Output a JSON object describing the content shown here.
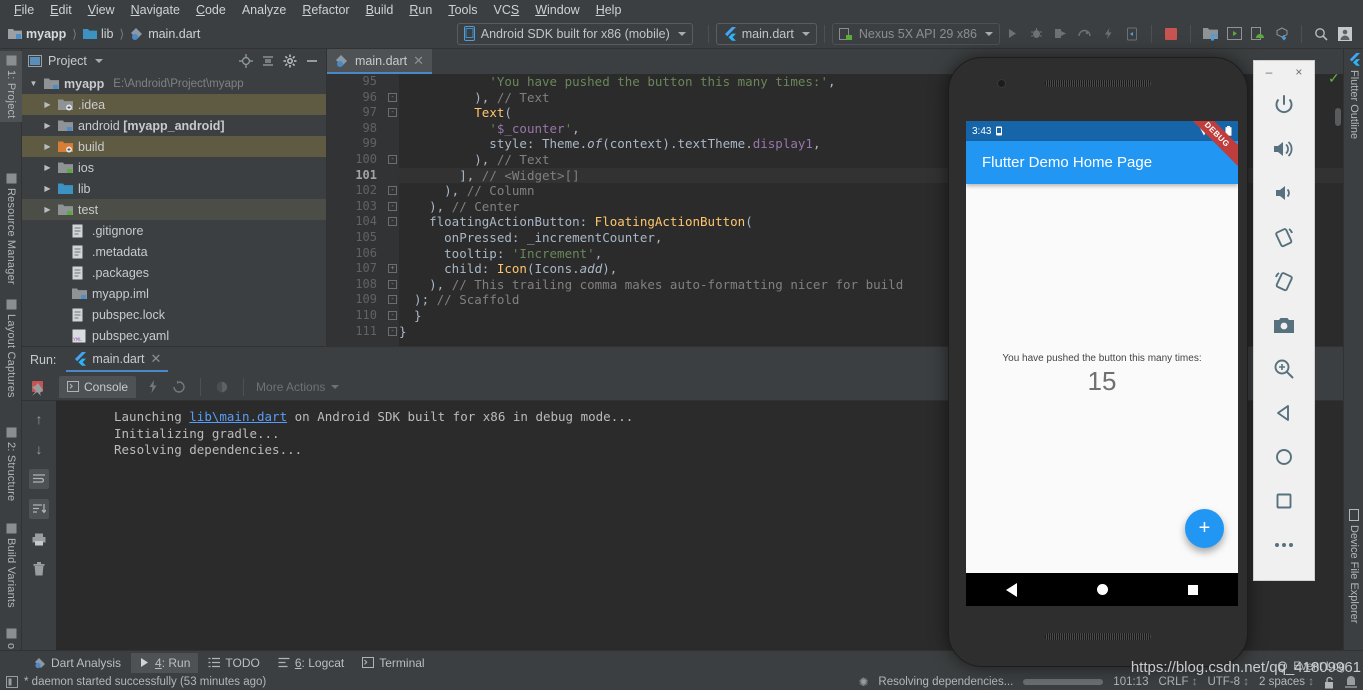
{
  "menu": {
    "items": [
      "File",
      "Edit",
      "View",
      "Navigate",
      "Code",
      "Analyze",
      "Refactor",
      "Build",
      "Run",
      "Tools",
      "VCS",
      "Window",
      "Help"
    ]
  },
  "toolbar": {
    "breadcrumbs": [
      "myapp",
      "lib",
      "main.dart"
    ],
    "device_combo": "Android SDK built for x86 (mobile)",
    "config_combo": "main.dart",
    "avd_combo": "Nexus 5X API 29 x86"
  },
  "left_rail": {
    "items": [
      "1: Project",
      "Resource Manager",
      "Layout Captures",
      "2: Structure",
      "Build Variants",
      "orites"
    ]
  },
  "right_rail": {
    "items": [
      "Flutter Outline",
      "Device File Explorer"
    ]
  },
  "project_panel": {
    "title": "Project",
    "tree": [
      {
        "label": "myapp",
        "path": "E:\\Android\\Project\\myapp",
        "indent": 0,
        "arrow": "down",
        "icon": "module-folder",
        "bold": true,
        "highlight": ""
      },
      {
        "label": ".idea",
        "path": "",
        "indent": 1,
        "arrow": "right",
        "icon": "idea-folder",
        "bold": false,
        "highlight": "a"
      },
      {
        "label": "android [myapp_android]",
        "path": "",
        "indent": 1,
        "arrow": "right",
        "icon": "module-folder",
        "bold": false,
        "highlight": ""
      },
      {
        "label": "build",
        "path": "",
        "indent": 1,
        "arrow": "right",
        "icon": "build-folder",
        "bold": false,
        "highlight": "a"
      },
      {
        "label": "ios",
        "path": "",
        "indent": 1,
        "arrow": "right",
        "icon": "ios-folder",
        "bold": false,
        "highlight": ""
      },
      {
        "label": "lib",
        "path": "",
        "indent": 1,
        "arrow": "right",
        "icon": "source-folder",
        "bold": false,
        "highlight": ""
      },
      {
        "label": "test",
        "path": "",
        "indent": 1,
        "arrow": "right",
        "icon": "test-folder",
        "bold": false,
        "highlight": "b"
      },
      {
        "label": ".gitignore",
        "path": "",
        "indent": 2,
        "arrow": "",
        "icon": "file",
        "bold": false,
        "highlight": ""
      },
      {
        "label": ".metadata",
        "path": "",
        "indent": 2,
        "arrow": "",
        "icon": "file",
        "bold": false,
        "highlight": ""
      },
      {
        "label": ".packages",
        "path": "",
        "indent": 2,
        "arrow": "",
        "icon": "file",
        "bold": false,
        "highlight": ""
      },
      {
        "label": "myapp.iml",
        "path": "",
        "indent": 2,
        "arrow": "",
        "icon": "module-folder",
        "bold": false,
        "highlight": ""
      },
      {
        "label": "pubspec.lock",
        "path": "",
        "indent": 2,
        "arrow": "",
        "icon": "file",
        "bold": false,
        "highlight": ""
      },
      {
        "label": "pubspec.yaml",
        "path": "",
        "indent": 2,
        "arrow": "",
        "icon": "yaml",
        "bold": false,
        "highlight": ""
      }
    ]
  },
  "editor": {
    "tab": "main.dart",
    "current_line": 101,
    "lines": [
      {
        "n": 95,
        "fold": "",
        "text": "            'You have pushed the button this many times:',",
        "segs": [
          {
            "t": "            ",
            "c": "pl"
          },
          {
            "t": "'You have pushed the button this many times:'",
            "c": "str"
          },
          {
            "t": ",",
            "c": "pl"
          }
        ]
      },
      {
        "n": 96,
        "fold": "-",
        "text": "          ), // Text",
        "segs": [
          {
            "t": "          ), ",
            "c": "pl"
          },
          {
            "t": "// Text",
            "c": "cm"
          }
        ]
      },
      {
        "n": 97,
        "fold": "-",
        "text": "          Text(",
        "segs": [
          {
            "t": "          ",
            "c": "pl"
          },
          {
            "t": "Text",
            "c": "cls"
          },
          {
            "t": "(",
            "c": "pl"
          }
        ]
      },
      {
        "n": 98,
        "fold": "",
        "text": "            '$_counter',",
        "segs": [
          {
            "t": "            ",
            "c": "pl"
          },
          {
            "t": "'",
            "c": "str"
          },
          {
            "t": "$_counter",
            "c": "fld"
          },
          {
            "t": "'",
            "c": "str"
          },
          {
            "t": ",",
            "c": "pl"
          }
        ]
      },
      {
        "n": 99,
        "fold": "",
        "text": "            style: Theme.of(context).textTheme.display1,",
        "segs": [
          {
            "t": "            style: Theme.",
            "c": "pl"
          },
          {
            "t": "of",
            "c": "it"
          },
          {
            "t": "(context).textTheme.",
            "c": "pl"
          },
          {
            "t": "display1",
            "c": "fld"
          },
          {
            "t": ",",
            "c": "pl"
          }
        ]
      },
      {
        "n": 100,
        "fold": "-",
        "text": "          ), // Text",
        "segs": [
          {
            "t": "          ), ",
            "c": "pl"
          },
          {
            "t": "// Text",
            "c": "cm"
          }
        ]
      },
      {
        "n": 101,
        "fold": "",
        "text": "        ], // <Widget>[]",
        "segs": [
          {
            "t": "        ], ",
            "c": "pl"
          },
          {
            "t": "// <Widget>[]",
            "c": "cm"
          }
        ]
      },
      {
        "n": 102,
        "fold": "-",
        "text": "      ), // Column",
        "segs": [
          {
            "t": "      ), ",
            "c": "pl"
          },
          {
            "t": "// Column",
            "c": "cm"
          }
        ]
      },
      {
        "n": 103,
        "fold": "-",
        "text": "    ), // Center",
        "segs": [
          {
            "t": "    ), ",
            "c": "pl"
          },
          {
            "t": "// Center",
            "c": "cm"
          }
        ]
      },
      {
        "n": 104,
        "fold": "-",
        "text": "    floatingActionButton: FloatingActionButton(",
        "segs": [
          {
            "t": "    floatingActionButton: ",
            "c": "pl"
          },
          {
            "t": "FloatingActionButton",
            "c": "cls"
          },
          {
            "t": "(",
            "c": "pl"
          }
        ]
      },
      {
        "n": 105,
        "fold": "",
        "text": "      onPressed: _incrementCounter,",
        "segs": [
          {
            "t": "      onPressed: ",
            "c": "pl"
          },
          {
            "t": "_incrementCounter",
            "c": "pl"
          },
          {
            "t": ",",
            "c": "pl"
          }
        ]
      },
      {
        "n": 106,
        "fold": "",
        "text": "      tooltip: 'Increment',",
        "segs": [
          {
            "t": "      tooltip: ",
            "c": "pl"
          },
          {
            "t": "'Increment'",
            "c": "str"
          },
          {
            "t": ",",
            "c": "pl"
          }
        ]
      },
      {
        "n": 107,
        "fold": "+",
        "text": "      child: Icon(Icons.add),",
        "segs": [
          {
            "t": "      child: ",
            "c": "pl"
          },
          {
            "t": "Icon",
            "c": "cls"
          },
          {
            "t": "(Icons.",
            "c": "pl"
          },
          {
            "t": "add",
            "c": "it"
          },
          {
            "t": "),",
            "c": "pl"
          }
        ]
      },
      {
        "n": 108,
        "fold": "-",
        "text": "    ), // This trailing comma makes auto-formatting nicer for build",
        "segs": [
          {
            "t": "    ), ",
            "c": "pl"
          },
          {
            "t": "// This trailing comma makes auto-formatting nicer for build",
            "c": "cm"
          }
        ]
      },
      {
        "n": 109,
        "fold": "-",
        "text": "  ); // Scaffold",
        "segs": [
          {
            "t": "  ); ",
            "c": "pl"
          },
          {
            "t": "// Scaffold",
            "c": "cm"
          }
        ]
      },
      {
        "n": 110,
        "fold": "-",
        "text": "  }",
        "segs": [
          {
            "t": "  }",
            "c": "pl"
          }
        ]
      },
      {
        "n": 111,
        "fold": "-",
        "text": "}",
        "segs": [
          {
            "t": "}",
            "c": "pl"
          }
        ]
      }
    ]
  },
  "run_panel": {
    "label": "Run:",
    "tab": "main.dart",
    "console_tab": "Console",
    "more_actions": "More Actions",
    "output": [
      {
        "pre": "Launching ",
        "link": "lib\\main.dart",
        "post": " on Android SDK built for x86 in debug mode..."
      },
      {
        "pre": "Initializing gradle...",
        "link": "",
        "post": ""
      },
      {
        "pre": "Resolving dependencies...",
        "link": "",
        "post": ""
      }
    ]
  },
  "bottom_bar": {
    "items": [
      {
        "label": "Dart Analysis",
        "icon": "dart-icon",
        "active": false,
        "mnemonic": ""
      },
      {
        "label": "4: Run",
        "icon": "play-icon",
        "active": true,
        "mnemonic": "4"
      },
      {
        "label": "TODO",
        "icon": "list-icon",
        "active": false,
        "mnemonic": ""
      },
      {
        "label": "6: Logcat",
        "icon": "logcat-icon",
        "active": false,
        "mnemonic": "6"
      },
      {
        "label": "Terminal",
        "icon": "terminal-icon",
        "active": false,
        "mnemonic": ""
      }
    ]
  },
  "status_bar": {
    "message": "* daemon started successfully (53 minutes ago)",
    "progress_text": "Resolving dependencies...",
    "caret": "101:13",
    "line_sep": "CRLF",
    "encoding": "UTF-8",
    "indent": "2 spaces",
    "event_log": "Event Log"
  },
  "emulator": {
    "phone_status_time": "3:43",
    "app_title": "Flutter Demo Home Page",
    "debug_banner": "DEBUG",
    "body_text": "You have pushed the button this many times:",
    "counter": "15",
    "fab_label": "+",
    "toolbar_buttons": [
      {
        "name": "power-icon",
        "label": "Power"
      },
      {
        "name": "volume-up-icon",
        "label": "Volume Up"
      },
      {
        "name": "volume-down-icon",
        "label": "Volume Down"
      },
      {
        "name": "rotate-left-icon",
        "label": "Rotate Left"
      },
      {
        "name": "rotate-right-icon",
        "label": "Rotate Right"
      },
      {
        "name": "camera-icon",
        "label": "Take Screenshot"
      },
      {
        "name": "zoom-icon",
        "label": "Zoom"
      },
      {
        "name": "back-icon",
        "label": "Back"
      },
      {
        "name": "home-icon",
        "label": "Home"
      },
      {
        "name": "overview-icon",
        "label": "Overview"
      },
      {
        "name": "more-icon",
        "label": "More"
      }
    ],
    "window_minimize": "–",
    "window_close": "×"
  },
  "watermark": "https://blog.csdn.net/qq_41809961",
  "colors": {
    "accent_blue": "#2196f3",
    "ide_bg": "#3c3f41",
    "editor_bg": "#2b2b2b",
    "debug_red": "#bf3d3d"
  }
}
